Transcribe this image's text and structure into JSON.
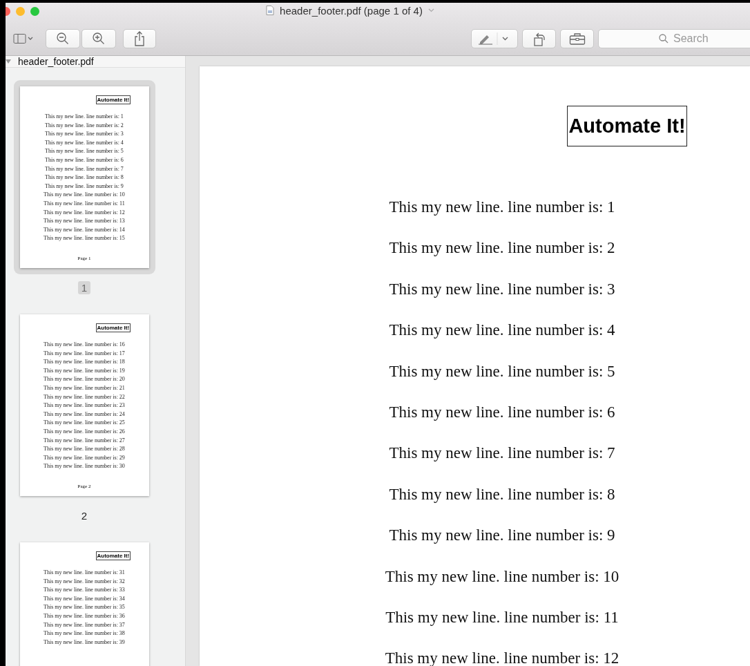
{
  "window": {
    "title": "header_footer.pdf (page 1 of 4)"
  },
  "toolbar": {
    "search": {
      "placeholder": "Search"
    }
  },
  "sidebar": {
    "title": "header_footer.pdf",
    "thumbnails": [
      {
        "label": "1",
        "selected": true,
        "title": "Automate It!",
        "lines": [
          "This my new line. line number is: 1",
          "This my new line. line number is: 2",
          "This my new line. line number is: 3",
          "This my new line. line number is: 4",
          "This my new line. line number is: 5",
          "This my new line. line number is: 6",
          "This my new line. line number is: 7",
          "This my new line. line number is: 8",
          "This my new line. line number is: 9",
          "This my new line. line number is: 10",
          "This my new line. line number is: 11",
          "This my new line. line number is: 12",
          "This my new line. line number is: 13",
          "This my new line. line number is: 14",
          "This my new line. line number is: 15"
        ],
        "footer": "Page 1"
      },
      {
        "label": "2",
        "selected": false,
        "title": "Automate It!",
        "lines": [
          "This my new line. line number is: 16",
          "This my new line. line number is: 17",
          "This my new line. line number is: 18",
          "This my new line. line number is: 19",
          "This my new line. line number is: 20",
          "This my new line. line number is: 21",
          "This my new line. line number is: 22",
          "This my new line. line number is: 23",
          "This my new line. line number is: 24",
          "This my new line. line number is: 25",
          "This my new line. line number is: 26",
          "This my new line. line number is: 27",
          "This my new line. line number is: 28",
          "This my new line. line number is: 29",
          "This my new line. line number is: 30"
        ],
        "footer": "Page 2"
      },
      {
        "selected": false,
        "title": "Automate It!",
        "lines": [
          "This my new line. line number is: 31",
          "This my new line. line number is: 32",
          "This my new line. line number is: 33",
          "This my new line. line number is: 34",
          "This my new line. line number is: 35",
          "This my new line. line number is: 36",
          "This my new line. line number is: 37",
          "This my new line. line number is: 38",
          "This my new line. line number is: 39"
        ]
      }
    ]
  },
  "document": {
    "title": "Automate It!",
    "lines": [
      "This my new line. line number is: 1",
      "This my new line. line number is: 2",
      "This my new line. line number is: 3",
      "This my new line. line number is: 4",
      "This my new line. line number is: 5",
      "This my new line. line number is: 6",
      "This my new line. line number is: 7",
      "This my new line. line number is: 8",
      "This my new line. line number is: 9",
      "This my new line. line number is: 10",
      "This my new line. line number is: 11",
      "This my new line. line number is: 12"
    ]
  }
}
